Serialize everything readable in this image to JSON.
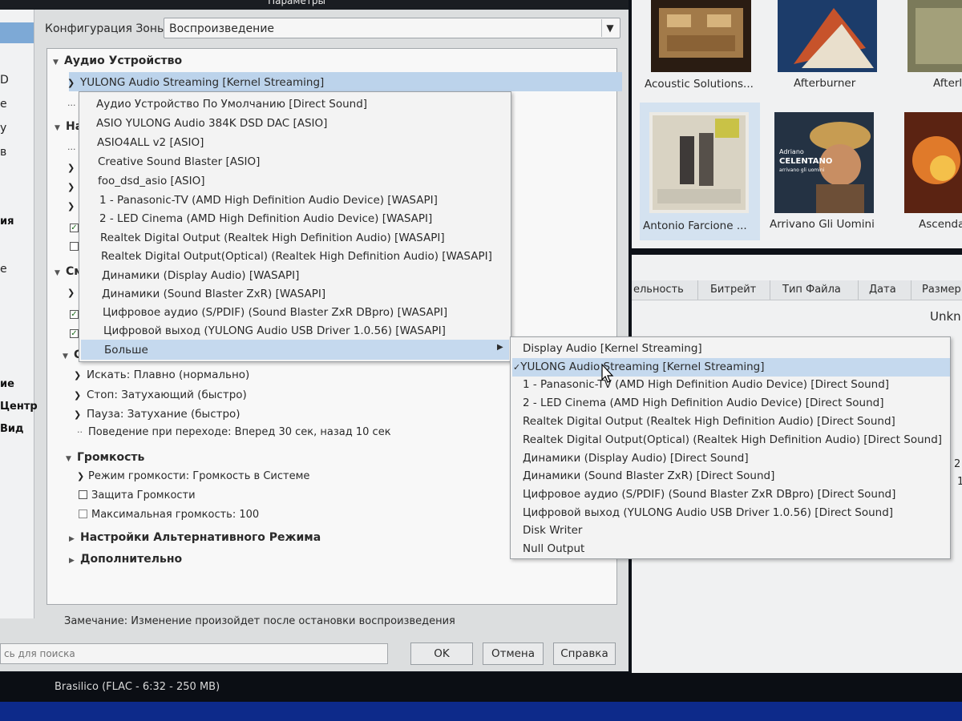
{
  "dialog": {
    "title": "Параметры",
    "zone_label": "Конфигурация Зоны:",
    "zone_value": "Воспроизведение",
    "note": "Замечание: Изменение произойдет после остановки воспроизведения",
    "search_placeholder": "сь для поиска",
    "ok_label": "OK",
    "cancel_label": "Отмена",
    "help_label": "Справка"
  },
  "left_nav": [
    "D",
    "е",
    "у",
    "в",
    "ия",
    "е",
    "ие",
    "Центр",
    "Вид"
  ],
  "tree": {
    "audio_device": "Аудио Устройство",
    "device_value": "YULONG Audio Streaming [Kernel Streaming]",
    "na_fragment": "На",
    "sm_fragment": "См",
    "st_fragment": "Ст",
    "seek": "Искать: Плавно (нормально)",
    "stop": "Стоп: Затухающий (быстро)",
    "pause": "Пауза: Затухание (быстро)",
    "transition": "Поведение при переходе: Вперед 30 сек, назад 10 сек",
    "volume": "Громкость",
    "volume_mode": "Режим громкости: Громкость в Системе",
    "volume_protect": "Защита Громкости",
    "max_volume": "Максимальная громкость: 100",
    "alt_mode": "Настройки Альтернативного Режима",
    "additional": "Дополнительно"
  },
  "menu1": {
    "items": [
      "Аудио Устройство По Умолчанию [Direct Sound]",
      "ASIO YULONG Audio 384K DSD DAC [ASIO]",
      "ASIO4ALL v2 [ASIO]",
      "Creative Sound Blaster [ASIO]",
      "foo_dsd_asio [ASIO]",
      "1 - Panasonic-TV (AMD High Definition Audio Device) [WASAPI]",
      "2 - LED Cinema (AMD High Definition Audio Device) [WASAPI]",
      "Realtek Digital Output (Realtek High Definition Audio) [WASAPI]",
      "Realtek Digital Output(Optical) (Realtek High Definition Audio) [WASAPI]",
      "Динамики (Display Audio) [WASAPI]",
      "Динамики (Sound Blaster ZxR) [WASAPI]",
      "Цифровое аудио (S/PDIF) (Sound Blaster ZxR DBpro) [WASAPI]",
      "Цифровой выход (YULONG Audio USB Driver 1.0.56) [WASAPI]"
    ],
    "more": "Больше"
  },
  "menu2": {
    "selected_index": 1,
    "items": [
      "Display Audio [Kernel Streaming]",
      "YULONG Audio Streaming [Kernel Streaming]",
      "1 - Panasonic-TV (AMD High Definition Audio Device) [Direct Sound]",
      "2 - LED Cinema (AMD High Definition Audio Device) [Direct Sound]",
      "Realtek Digital Output (Realtek High Definition Audio) [Direct Sound]",
      "Realtek Digital Output(Optical) (Realtek High Definition Audio) [Direct Sound]",
      "Динамики (Display Audio) [Direct Sound]",
      "Динамики (Sound Blaster ZxR) [Direct Sound]",
      "Цифровое аудио (S/PDIF) (Sound Blaster ZxR DBpro) [Direct Sound]",
      "Цифровой выход (YULONG Audio USB Driver 1.0.56) [Direct Sound]",
      "Disk Writer",
      "Null Output"
    ]
  },
  "albums": [
    {
      "title": "Acoustic Solutions..."
    },
    {
      "title": "Afterburner"
    },
    {
      "title": "Afterl"
    },
    {
      "title": "Antonio Farcione ..."
    },
    {
      "title": "Arrivano Gli Uomini",
      "cover_text": [
        "Adriano",
        "CELENTANO",
        "arrivano gli uomini"
      ]
    },
    {
      "title": "Ascenda"
    }
  ],
  "track_columns": [
    "ельность",
    "Битрейт",
    "Тип Файла",
    "Дата",
    "Размер"
  ],
  "track_fragments": {
    "unknown": "Unkn",
    "digit_a": "2",
    "digit_b": "1"
  },
  "status_bar": "Brasilico (FLAC - 6:32 - 250 MB)",
  "colors": {
    "selection": "#bcd3eb",
    "menu_highlight": "#c5d9ee",
    "taskbar": "#0d2a8a"
  }
}
